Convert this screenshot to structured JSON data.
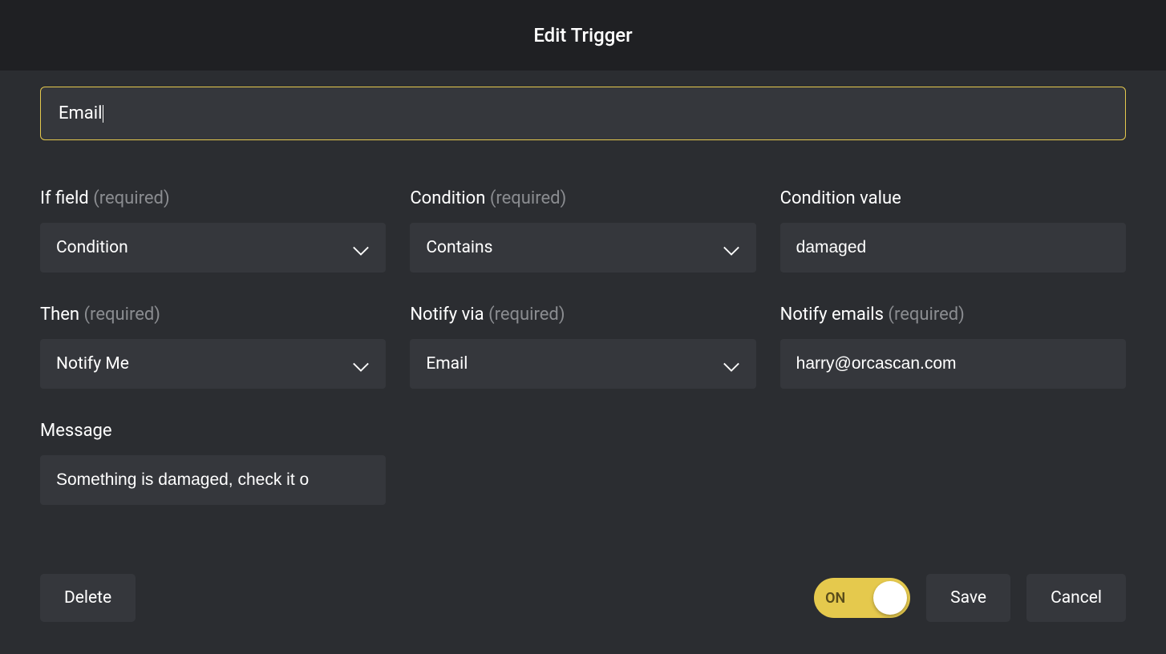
{
  "modal": {
    "title": "Edit Trigger",
    "name_value": "Email"
  },
  "fields": {
    "if_field": {
      "label": "If field",
      "required": "(required)",
      "value": "Condition"
    },
    "condition": {
      "label": "Condition",
      "required": "(required)",
      "value": "Contains"
    },
    "condition_value": {
      "label": "Condition value",
      "value": "damaged"
    },
    "then": {
      "label": "Then",
      "required": "(required)",
      "value": "Notify Me"
    },
    "notify_via": {
      "label": "Notify via",
      "required": "(required)",
      "value": "Email"
    },
    "notify_emails": {
      "label": "Notify emails",
      "required": "(required)",
      "value": "harry@orcascan.com"
    },
    "message": {
      "label": "Message",
      "value": "Something is damaged, check it o"
    }
  },
  "footer": {
    "delete": "Delete",
    "toggle_state": "ON",
    "save": "Save",
    "cancel": "Cancel"
  }
}
